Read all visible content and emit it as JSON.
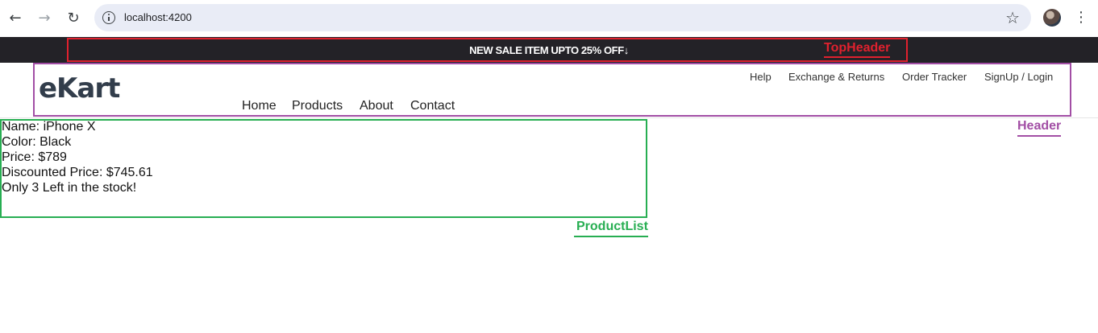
{
  "browser": {
    "url": "localhost:4200",
    "back_icon": "arrow-left",
    "forward_icon": "arrow-right",
    "reload_icon": "reload",
    "bookmark_icon": "star"
  },
  "top_header": {
    "sale_text": "NEW SALE ITEM UPTO 25% OFF",
    "sale_arrow": "↓",
    "annotation_label": "TopHeader",
    "annotation_color": "#e0212e",
    "background": "#232227"
  },
  "header": {
    "logo": "eKart",
    "util_links": [
      "Help",
      "Exchange & Returns",
      "Order Tracker",
      "SignUp / Login"
    ],
    "nav_links": [
      "Home",
      "Products",
      "About",
      "Contact"
    ],
    "annotation_label": "Header",
    "annotation_color": "#a24ea5"
  },
  "product_list": {
    "lines": [
      "Name: iPhone X",
      "Color: Black",
      "Price: $789",
      "Discounted Price: $745.61",
      "Only 3 Left in the stock!"
    ],
    "annotation_label": "ProductList",
    "annotation_color": "#27ae52"
  }
}
